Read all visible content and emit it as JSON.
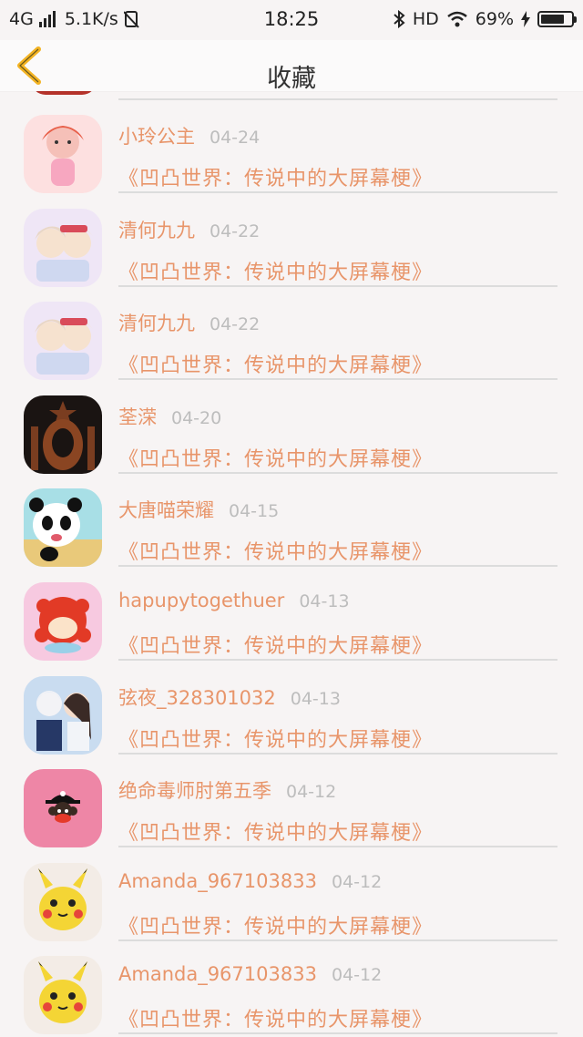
{
  "status": {
    "network": "4G",
    "speed": "5.1K/s",
    "time": "18:25",
    "hd": "HD",
    "battery_percent": "69%",
    "battery_level": 0.69
  },
  "nav": {
    "title": "收藏",
    "back_icon": "chevron-left-icon",
    "accent": "#f3b323"
  },
  "colors": {
    "name": "#e8956a",
    "date": "#bdbdbd",
    "divider": "#dcdcdc"
  },
  "items": [
    {
      "name": "小玲公主",
      "date": "04-24",
      "title": "《凹凸世界：传说中的大屏幕梗》",
      "avatar": "princess-avatar"
    },
    {
      "name": "清何九九",
      "date": "04-22",
      "title": "《凹凸世界：传说中的大屏幕梗》",
      "avatar": "anime-pair-avatar"
    },
    {
      "name": "清何九九",
      "date": "04-22",
      "title": "《凹凸世界：传说中的大屏幕梗》",
      "avatar": "anime-pair-avatar"
    },
    {
      "name": "荃溁",
      "date": "04-20",
      "title": "《凹凸世界：传说中的大屏幕梗》",
      "avatar": "siren-logo-avatar"
    },
    {
      "name": "大唐喵荣耀",
      "date": "04-15",
      "title": "《凹凸世界：传说中的大屏幕梗》",
      "avatar": "panda-avatar"
    },
    {
      "name": "hapupytogethuer",
      "date": "04-13",
      "title": "《凹凸世界：传说中的大屏幕梗》",
      "avatar": "red-monkey-avatar"
    },
    {
      "name": "弦夜_328301032",
      "date": "04-13",
      "title": "《凹凸世界：传说中的大屏幕梗》",
      "avatar": "anime-couple-avatar"
    },
    {
      "name": "绝命毒师肘第五季",
      "date": "04-12",
      "title": "《凹凸世界：传说中的大屏幕梗》",
      "avatar": "pirate-monkey-avatar"
    },
    {
      "name": "Amanda_967103833",
      "date": "04-12",
      "title": "《凹凸世界：传说中的大屏幕梗》",
      "avatar": "pikachu-avatar"
    },
    {
      "name": "Amanda_967103833",
      "date": "04-12",
      "title": "《凹凸世界：传说中的大屏幕梗》",
      "avatar": "pikachu-avatar"
    }
  ]
}
